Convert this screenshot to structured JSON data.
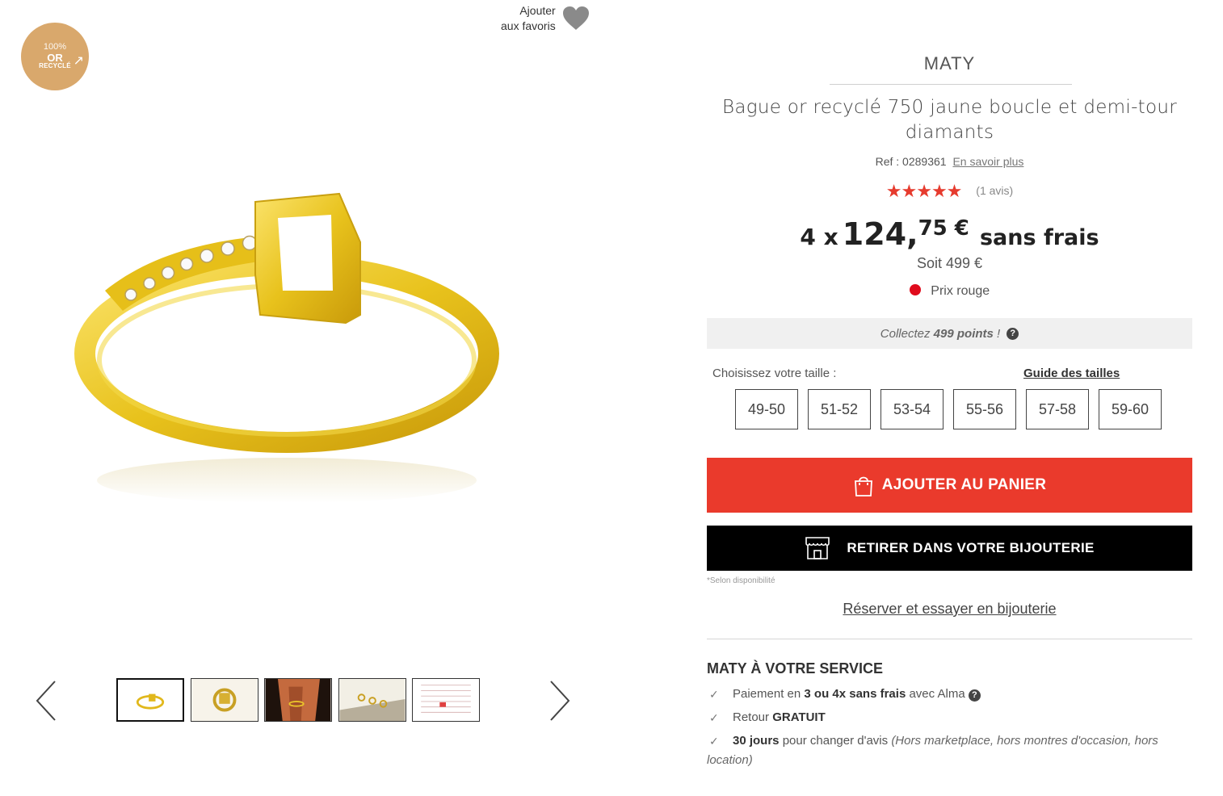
{
  "badge": {
    "line1": "100%",
    "line2": "OR",
    "line3": "RECYCLÉ"
  },
  "favorites": {
    "line1": "Ajouter",
    "line2": "aux favoris",
    "icon": "heart-icon"
  },
  "gallery": {
    "thumbnails": [
      "ring-front",
      "ring-top",
      "ring-on-hand",
      "ring-group",
      "size-chart"
    ],
    "active_index": 0
  },
  "product": {
    "brand": "MATY",
    "title": "Bague or recyclé 750 jaune boucle et demi-tour diamants",
    "ref_label": "Ref : 0289361",
    "ref_link": "En savoir plus",
    "rating": 5,
    "reviews": "(1 avis)",
    "installments": "4 x",
    "installment_int": "124,",
    "installment_dec": "75 €",
    "installment_terms": "sans frais",
    "total": "Soit 499 €",
    "price_tag": "Prix rouge",
    "price_tag_color": "#e00b1c"
  },
  "points": {
    "prefix": "Collectez",
    "amount": "499 points",
    "suffix": "!"
  },
  "sizes": {
    "label": "Choisissez votre taille :",
    "guide": "Guide des tailles",
    "options": [
      "49-50",
      "51-52",
      "53-54",
      "55-56",
      "57-58",
      "59-60"
    ]
  },
  "actions": {
    "add_to_cart": "AJOUTER AU PANIER",
    "pickup": "RETIRER DANS VOTRE BIJOUTERIE",
    "salon_note": "*Selon disponibilité",
    "reserve": "Réserver et essayer en bijouterie",
    "cart_color": "#ea3a2c"
  },
  "service": {
    "title": "MATY À VOTRE SERVICE",
    "item1_a": "Paiement en ",
    "item1_b": "3 ou 4x sans frais",
    "item1_c": " avec Alma",
    "item2_a": "Retour ",
    "item2_b": "GRATUIT",
    "item3_a": "30 jours",
    "item3_b": " pour changer d'avis ",
    "item3_c": "(Hors marketplace, hors montres d'occasion, hors location)"
  }
}
